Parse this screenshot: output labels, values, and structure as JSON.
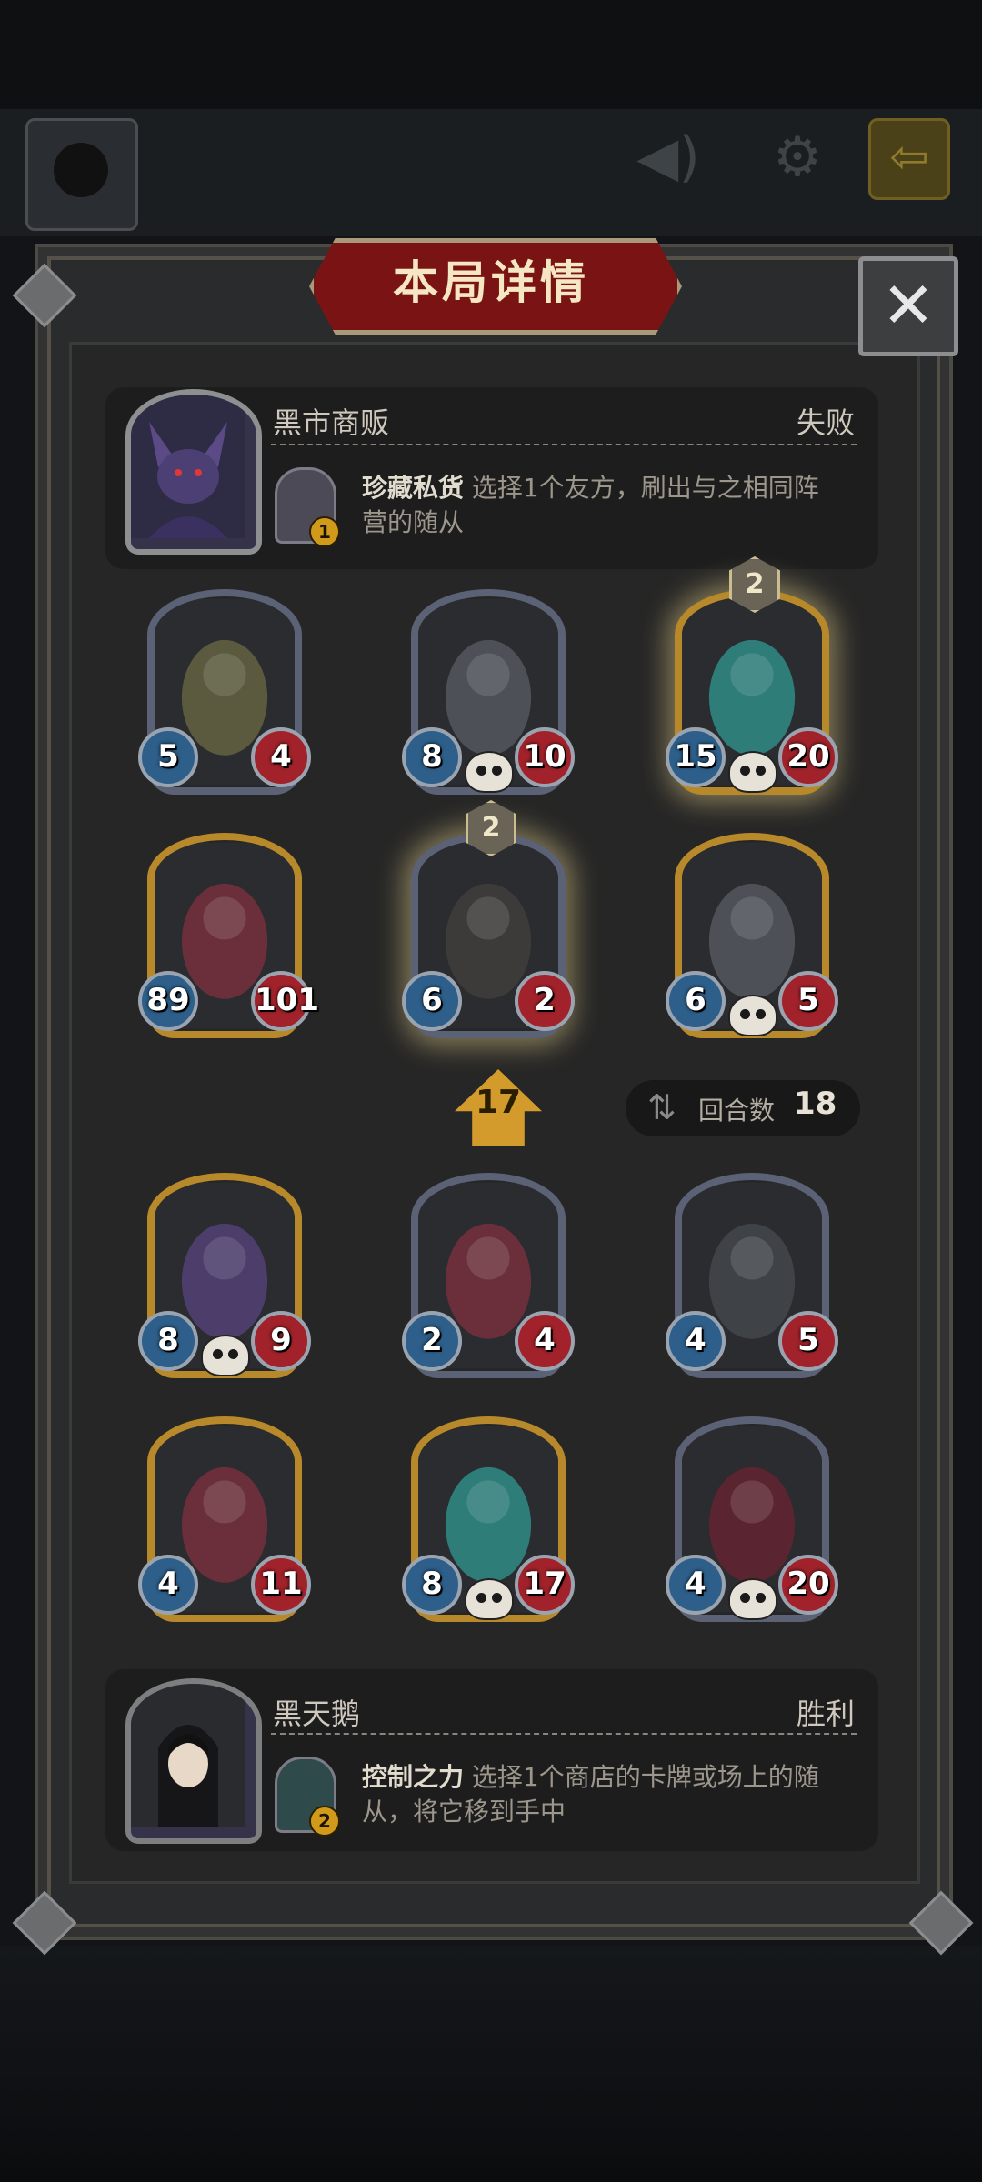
{
  "panel": {
    "title": "本局详情",
    "close_label": "✕"
  },
  "top_bar": {
    "speaker_icon": "speaker-icon",
    "settings_icon": "gear-icon",
    "exit_icon": "exit-icon"
  },
  "opponent": {
    "name": "黑市商贩",
    "result": "失败",
    "skill_name": "珍藏私货",
    "skill_desc_line1": " 选择1个友方，刷出与之相同阵",
    "skill_desc_line2": "营的随从",
    "skill_cost": "1"
  },
  "player": {
    "name": "黑天鹅",
    "result": "胜利",
    "skill_name": "控制之力",
    "skill_desc_line1": " 选择1个商店的卡牌或场上的随",
    "skill_desc_line2": "从，将它移到手中",
    "skill_cost": "2"
  },
  "tavern_tier": "17",
  "round": {
    "label": "回合数",
    "value": "18"
  },
  "opponent_board": [
    {
      "attack": "5",
      "health": "4",
      "tier": "",
      "gold": false,
      "skull": false
    },
    {
      "attack": "8",
      "health": "10",
      "tier": "",
      "gold": false,
      "skull": true
    },
    {
      "attack": "15",
      "health": "20",
      "tier": "2",
      "gold": true,
      "skull": true
    },
    {
      "attack": "89",
      "health": "101",
      "tier": "",
      "gold": true,
      "skull": false
    },
    {
      "attack": "6",
      "health": "2",
      "tier": "2",
      "gold": false,
      "skull": false
    },
    {
      "attack": "6",
      "health": "5",
      "tier": "",
      "gold": true,
      "skull": true
    }
  ],
  "player_board": [
    {
      "attack": "8",
      "health": "9",
      "tier": "",
      "gold": true,
      "skull": true
    },
    {
      "attack": "2",
      "health": "4",
      "tier": "",
      "gold": false,
      "skull": false
    },
    {
      "attack": "4",
      "health": "5",
      "tier": "",
      "gold": false,
      "skull": false
    },
    {
      "attack": "4",
      "health": "11",
      "tier": "",
      "gold": true,
      "skull": false
    },
    {
      "attack": "8",
      "health": "17",
      "tier": "",
      "gold": true,
      "skull": true
    },
    {
      "attack": "4",
      "health": "20",
      "tier": "",
      "gold": false,
      "skull": true
    }
  ]
}
